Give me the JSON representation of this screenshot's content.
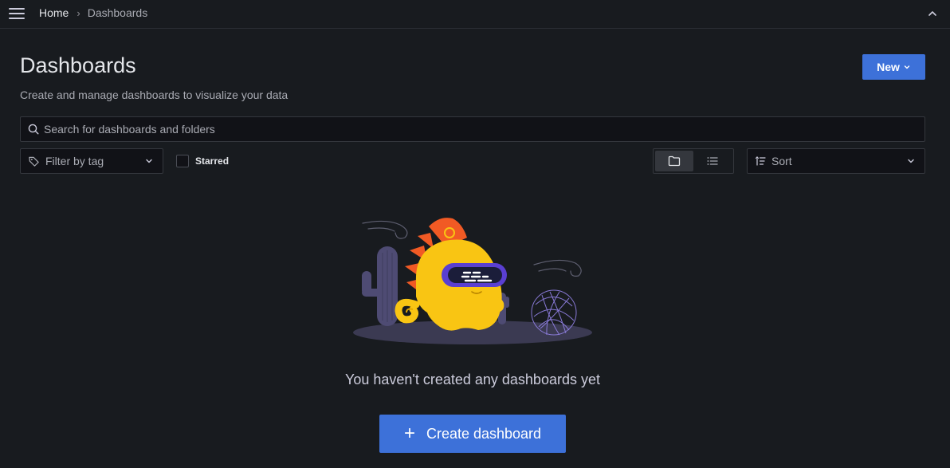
{
  "breadcrumb": {
    "home": "Home",
    "current": "Dashboards"
  },
  "header": {
    "title": "Dashboards",
    "subtitle": "Create and manage dashboards to visualize your data",
    "new_button": "New"
  },
  "search": {
    "placeholder": "Search for dashboards and folders",
    "value": ""
  },
  "filters": {
    "tag_filter_label": "Filter by tag",
    "starred_label": "Starred",
    "starred_checked": false,
    "view_mode": "folders",
    "sort_label": "Sort"
  },
  "empty_state": {
    "message": "You haven't created any dashboards yet",
    "create_button": "Create dashboard",
    "create_icon": "+"
  },
  "colors": {
    "background": "#181b1f",
    "primary": "#3d71d9",
    "mascot": "#f9c513",
    "mascot_flame": "#f15a24",
    "cactus": "#4e4b73",
    "visor": "#5a3fd1"
  },
  "icons": {
    "menu": "hamburger-icon",
    "collapse": "chevron-up-icon",
    "search": "search-icon",
    "tag": "tag-icon",
    "folder_view": "folder-icon",
    "list_view": "list-icon",
    "sort": "sort-icon"
  }
}
